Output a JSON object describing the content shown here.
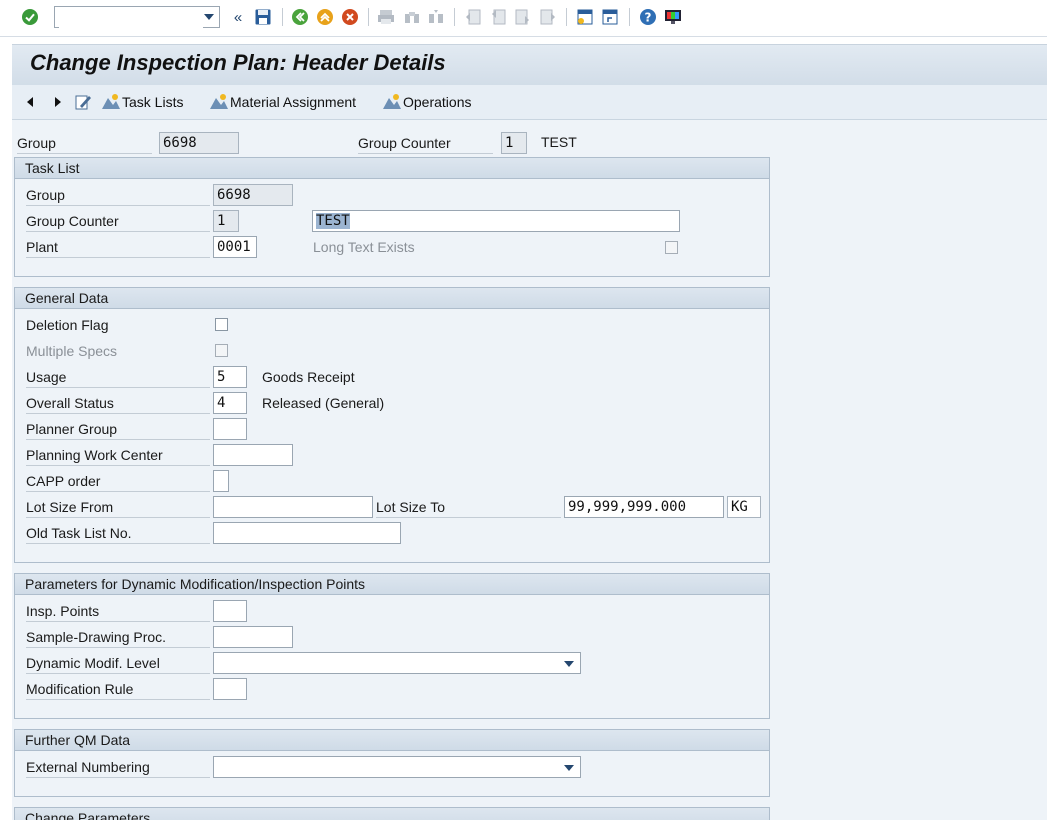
{
  "toolbar": {
    "command_field_value": "",
    "icons": [
      "enter-check-icon",
      "back-icon",
      "exit-icon",
      "cancel-icon",
      "print-icon",
      "find-icon",
      "find-next-icon",
      "first-page-icon",
      "previous-page-icon",
      "next-page-icon",
      "last-page-icon",
      "create-session-icon",
      "shortcut-icon",
      "help-icon",
      "customize-layout-icon"
    ],
    "history_glyph": "«"
  },
  "title": "Change Inspection Plan: Header Details",
  "app_toolbar": {
    "task_lists": "Task Lists",
    "material_assignment": "Material Assignment",
    "operations": "Operations"
  },
  "header": {
    "group_label": "Group",
    "group_value": "6698",
    "group_counter_label": "Group Counter",
    "group_counter_value": "1",
    "group_counter_desc": "TEST"
  },
  "task_list": {
    "title": "Task List",
    "group_label": "Group",
    "group_value": "6698",
    "group_counter_label": "Group Counter",
    "group_counter_value": "1",
    "description_value": "TEST",
    "plant_label": "Plant",
    "plant_value": "0001",
    "long_text_label": "Long Text Exists"
  },
  "general_data": {
    "title": "General Data",
    "deletion_flag_label": "Deletion Flag",
    "multiple_specs_label": "Multiple Specs",
    "usage_label": "Usage",
    "usage_value": "5",
    "usage_desc": "Goods Receipt",
    "overall_status_label": "Overall Status",
    "overall_status_value": "4",
    "overall_status_desc": "Released (General)",
    "planner_group_label": "Planner Group",
    "planner_group_value": "",
    "planning_work_center_label": "Planning Work Center",
    "planning_work_center_value": "",
    "capp_order_label": "CAPP order",
    "capp_order_value": "",
    "lot_size_from_label": "Lot Size From",
    "lot_size_from_value": "",
    "lot_size_to_label": "Lot Size To",
    "lot_size_to_value": "99,999,999.000",
    "lot_size_unit": "KG",
    "old_task_list_label": "Old Task List No.",
    "old_task_list_value": ""
  },
  "dynamic_mod": {
    "title": "Parameters for Dynamic Modification/Inspection Points",
    "insp_points_label": "Insp. Points",
    "insp_points_value": "",
    "sample_drawing_label": "Sample-Drawing Proc.",
    "sample_drawing_value": "",
    "dynamic_modif_level_label": "Dynamic Modif. Level",
    "dynamic_modif_level_value": "",
    "modification_rule_label": "Modification Rule",
    "modification_rule_value": ""
  },
  "further_qm": {
    "title": "Further QM Data",
    "external_numbering_label": "External Numbering",
    "external_numbering_value": ""
  },
  "change_params": {
    "title": "Change Parameters"
  }
}
